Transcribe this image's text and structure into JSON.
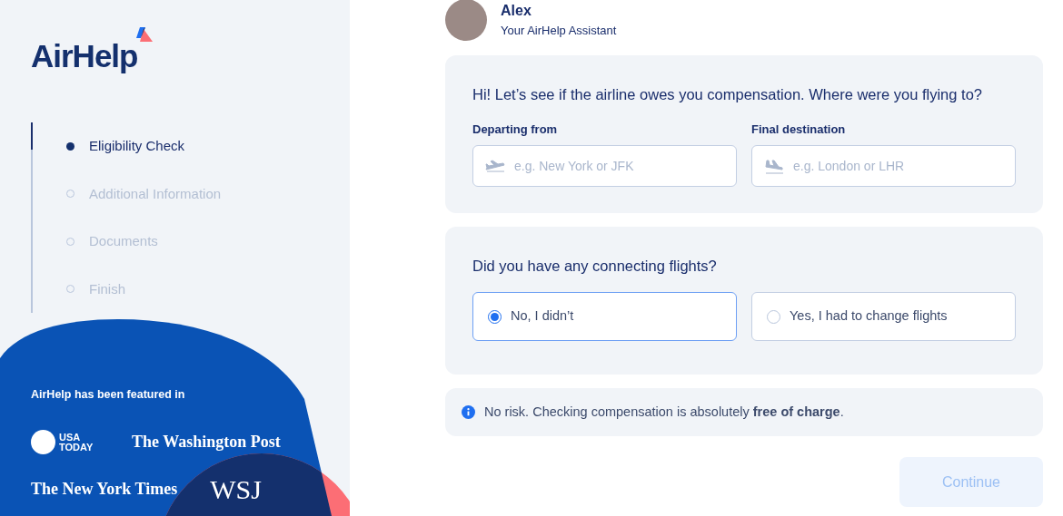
{
  "sidebar": {
    "logo": "AirHelp",
    "steps": [
      {
        "label": "Eligibility Check",
        "selected": true
      },
      {
        "label": "Additional Information",
        "selected": false
      },
      {
        "label": "Documents",
        "selected": false
      },
      {
        "label": "Finish",
        "selected": false
      }
    ],
    "featured": {
      "title": "AirHelp has been featured in",
      "logos": [
        {
          "kind": "usatoday",
          "lines": [
            "USA",
            "TODAY"
          ]
        },
        {
          "kind": "gothic",
          "text": "The Washington Post"
        },
        {
          "kind": "gothic",
          "text": "The New York Times"
        },
        {
          "kind": "serif",
          "text": "WSJ"
        }
      ]
    }
  },
  "assistant": {
    "name": "Alex",
    "role": "Your AirHelp Assistant"
  },
  "route_card": {
    "question": "Hi! Let’s see if the airline owes you compensation. Where were you flying to?",
    "fields": [
      {
        "kind": "takeoff",
        "label": "Departing from",
        "placeholder": "e.g. New York or JFK"
      },
      {
        "kind": "landing",
        "label": "Final destination",
        "placeholder": "e.g. London or LHR"
      }
    ]
  },
  "connection_card": {
    "question": "Did you have any connecting flights?",
    "options": [
      {
        "label": "No, I didn’t",
        "selected": true
      },
      {
        "label": "Yes, I had to change flights",
        "selected": false
      }
    ]
  },
  "notice": "No risk. Checking compensation is absolutely **free of charge**.",
  "continue_button": {
    "label": "Continue",
    "disabled": true
  }
}
